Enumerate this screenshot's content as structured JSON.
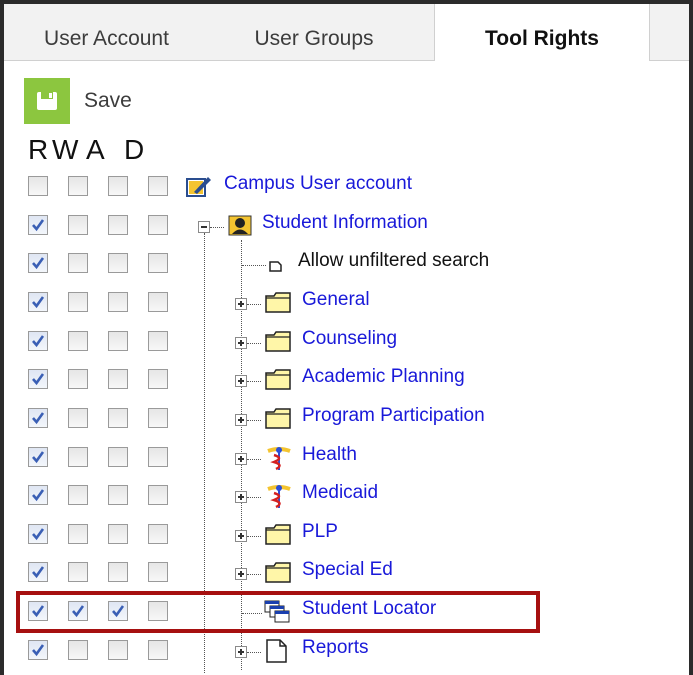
{
  "tabs": [
    {
      "label": "User Account",
      "active": false
    },
    {
      "label": "User Groups",
      "active": false
    },
    {
      "label": "Tool Rights",
      "active": true
    }
  ],
  "toolbar": {
    "save_label": "Save"
  },
  "rights_header": {
    "r": "R",
    "w": "W",
    "a": "A",
    "d": "D"
  },
  "tree": [
    {
      "label": "Campus User account",
      "icon": "campus-account-icon",
      "R": false,
      "W": false,
      "A": false,
      "D": false
    },
    {
      "label": "Student Information",
      "icon": "student-info-icon",
      "R": true,
      "W": false,
      "A": false,
      "D": false
    },
    {
      "label": "Allow unfiltered search",
      "icon": "tool-leaf-icon",
      "R": true,
      "W": false,
      "A": false,
      "D": false
    },
    {
      "label": "General",
      "icon": "folder-icon",
      "R": true,
      "W": false,
      "A": false,
      "D": false
    },
    {
      "label": "Counseling",
      "icon": "folder-icon",
      "R": true,
      "W": false,
      "A": false,
      "D": false
    },
    {
      "label": "Academic Planning",
      "icon": "folder-icon",
      "R": true,
      "W": false,
      "A": false,
      "D": false
    },
    {
      "label": "Program Participation",
      "icon": "folder-icon",
      "R": true,
      "W": false,
      "A": false,
      "D": false
    },
    {
      "label": "Health",
      "icon": "caduceus-icon",
      "R": true,
      "W": false,
      "A": false,
      "D": false
    },
    {
      "label": "Medicaid",
      "icon": "caduceus-icon",
      "R": true,
      "W": false,
      "A": false,
      "D": false
    },
    {
      "label": "PLP",
      "icon": "folder-icon",
      "R": true,
      "W": false,
      "A": false,
      "D": false
    },
    {
      "label": "Special Ed",
      "icon": "folder-icon",
      "R": true,
      "W": false,
      "A": false,
      "D": false
    },
    {
      "label": "Student Locator",
      "icon": "window-stack-icon",
      "R": true,
      "W": true,
      "A": true,
      "D": false,
      "highlighted": true
    },
    {
      "label": "Reports",
      "icon": "document-icon",
      "R": true,
      "W": false,
      "A": false,
      "D": false
    }
  ],
  "colors": {
    "link": "#1919d9",
    "save_green": "#8cc63f",
    "highlight_border": "#a61010",
    "check": "#3a5fb5"
  }
}
